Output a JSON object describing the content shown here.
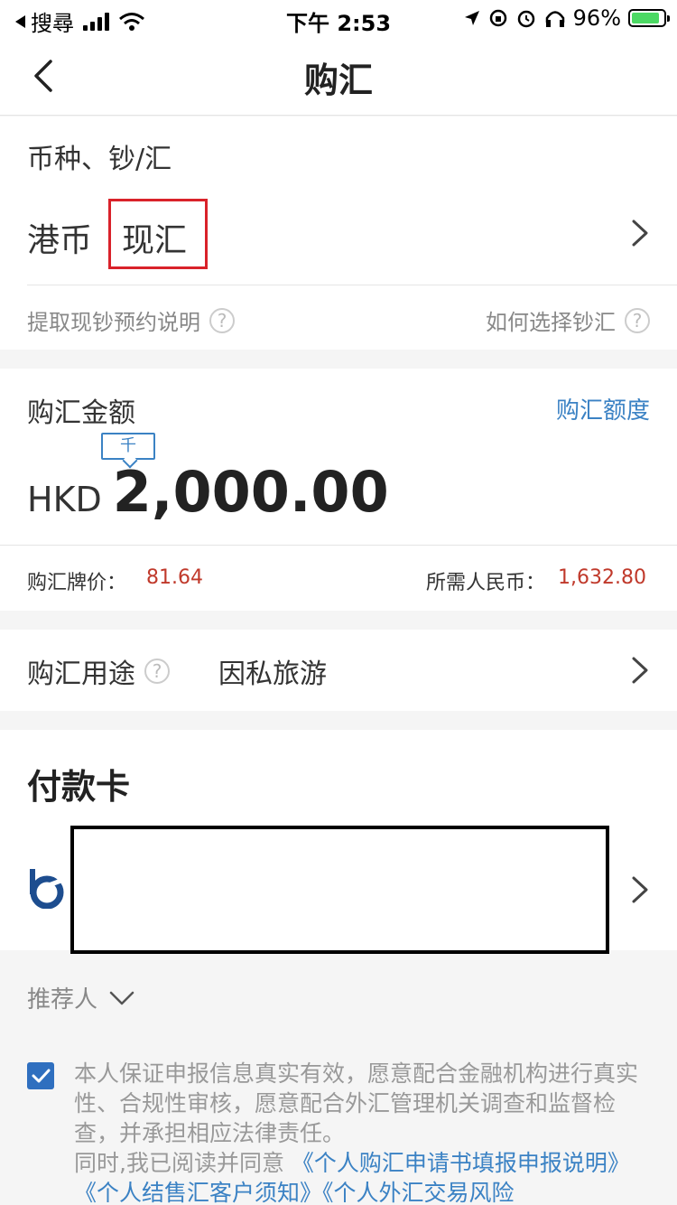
{
  "status_bar": {
    "carrier": "搜尋",
    "time": "下午 2:53",
    "battery": "96%",
    "battery_level": 0.96
  },
  "nav": {
    "title": "购汇"
  },
  "currency_section": {
    "label": "币种、钞/汇",
    "currency": "港币",
    "cash_or_exchange": "现汇",
    "left_link": "提取现钞预约说明",
    "right_link": "如何选择钞汇"
  },
  "amount_section": {
    "label": "购汇金额",
    "quota_link": "购汇额度",
    "unit_tag": "千",
    "currency_code": "HKD",
    "amount": "2,000.00",
    "rate_label": "购汇牌价：",
    "rate_value": "81.64",
    "rmb_label": "所需人民币：",
    "rmb_value": "1,632.80"
  },
  "purpose_section": {
    "label": "购汇用途",
    "value": "因私旅游"
  },
  "payment_section": {
    "heading": "付款卡"
  },
  "referrer": {
    "label": "推荐人"
  },
  "agreement": {
    "checked": true,
    "text": "本人保证申报信息真实有效，愿意配合金融机构进行真实性、合规性审核，愿意配合外汇管理机关调查和监督检查，并承担相应法律责任。",
    "prefix": "同时,我已阅读并同意",
    "links": "《个人购汇申请书填报申报说明》《个人结售汇客户须知》《个人外汇交易风险"
  },
  "colors": {
    "accent_blue": "#3b82c4",
    "highlight_red": "#d9222a",
    "value_red": "#c0392b"
  }
}
